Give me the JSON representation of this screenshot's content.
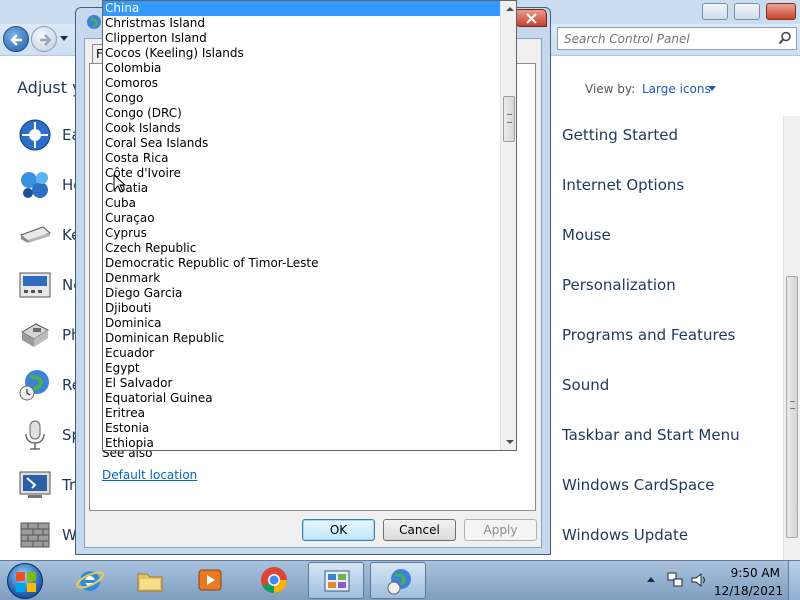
{
  "control_panel": {
    "search_placeholder": "Search Control Panel",
    "heading": "Adjust y",
    "view_by_label": "View by:",
    "view_by_value": "Large icons",
    "left_items": [
      {
        "label": "Ea",
        "icon": "ease-of-access-icon"
      },
      {
        "label": "Ho",
        "icon": "homegroup-icon"
      },
      {
        "label": "Ke",
        "icon": "keyboard-icon"
      },
      {
        "label": "Ne",
        "icon": "network-icon"
      },
      {
        "label": "Ph",
        "icon": "phone-modem-icon"
      },
      {
        "label": "Re",
        "icon": "region-globe-icon"
      },
      {
        "label": "Sp",
        "icon": "speech-microphone-icon"
      },
      {
        "label": "Tr",
        "icon": "troubleshooting-icon"
      },
      {
        "label": "W",
        "icon": "windows-firewall-icon"
      }
    ],
    "right_items": [
      "Getting Started",
      "Internet Options",
      "Mouse",
      "Personalization",
      "Programs and Features",
      "Sound",
      "Taskbar and Start Menu",
      "Windows CardSpace",
      "Windows Update"
    ]
  },
  "dialog": {
    "tab_label": "F",
    "see_also": "See also",
    "default_location_link": "Default location",
    "ok_label": "OK",
    "cancel_label": "Cancel",
    "apply_label": "Apply"
  },
  "country_list": {
    "selected": "China",
    "items": [
      "China",
      "Christmas Island",
      "Clipperton Island",
      "Cocos (Keeling) Islands",
      "Colombia",
      "Comoros",
      "Congo",
      "Congo (DRC)",
      "Cook Islands",
      "Coral Sea Islands",
      "Costa Rica",
      "Côte d'Ivoire",
      "Croatia",
      "Cuba",
      "Curaçao",
      "Cyprus",
      "Czech Republic",
      "Democratic Republic of Timor-Leste",
      "Denmark",
      "Diego Garcia",
      "Djibouti",
      "Dominica",
      "Dominican Republic",
      "Ecuador",
      "Egypt",
      "El Salvador",
      "Equatorial Guinea",
      "Eritrea",
      "Estonia",
      "Ethiopia"
    ]
  },
  "taskbar": {
    "time": "9:50 AM",
    "date": "12/18/2021",
    "apps": [
      "internet-explorer-icon",
      "windows-explorer-icon",
      "media-player-icon",
      "chrome-icon",
      "control-panel-icon",
      "region-globe-icon"
    ]
  },
  "colors": {
    "selection": "#3399ff",
    "link": "#0066cc",
    "cp_text": "#1e395b"
  }
}
